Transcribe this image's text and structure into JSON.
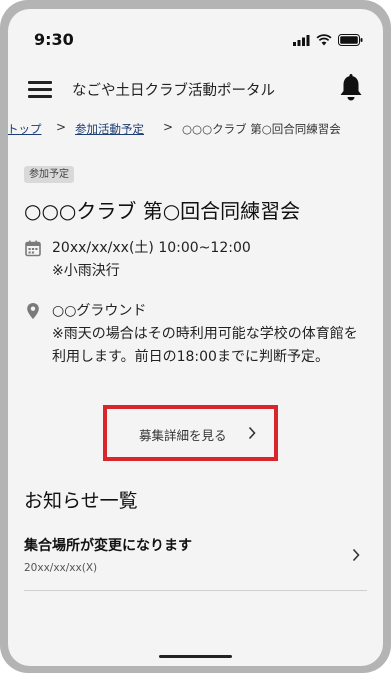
{
  "status_bar": {
    "time": "9:30"
  },
  "header": {
    "title": "なごや土日クラブ活動ポータル"
  },
  "breadcrumb": {
    "items": [
      "トップ",
      "参加活動予定",
      "○○○クラブ 第○回合同練習会"
    ],
    "separator": ">"
  },
  "event": {
    "badge": "参加予定",
    "title": "○○○クラブ 第○回合同練習会",
    "datetime": "20xx/xx/xx(土) 10:00~12:00",
    "weather_note": "※小雨決行",
    "location": "○○グラウンド",
    "location_note": "※雨天の場合はその時利用可能な学校の体育館を利用します。前日の18:00までに判断予定。",
    "detail_button": "募集詳細を見る"
  },
  "notices": {
    "title": "お知らせ一覧",
    "items": [
      {
        "title": "集合場所が変更になります",
        "date": "20xx/xx/xx(X)"
      }
    ]
  },
  "colors": {
    "screen_bg": "#f4f4f4",
    "frame": "#b4b4b4",
    "highlight_border": "#d9262e",
    "link": "#1c3e73",
    "icon": "#7a7a7a"
  }
}
